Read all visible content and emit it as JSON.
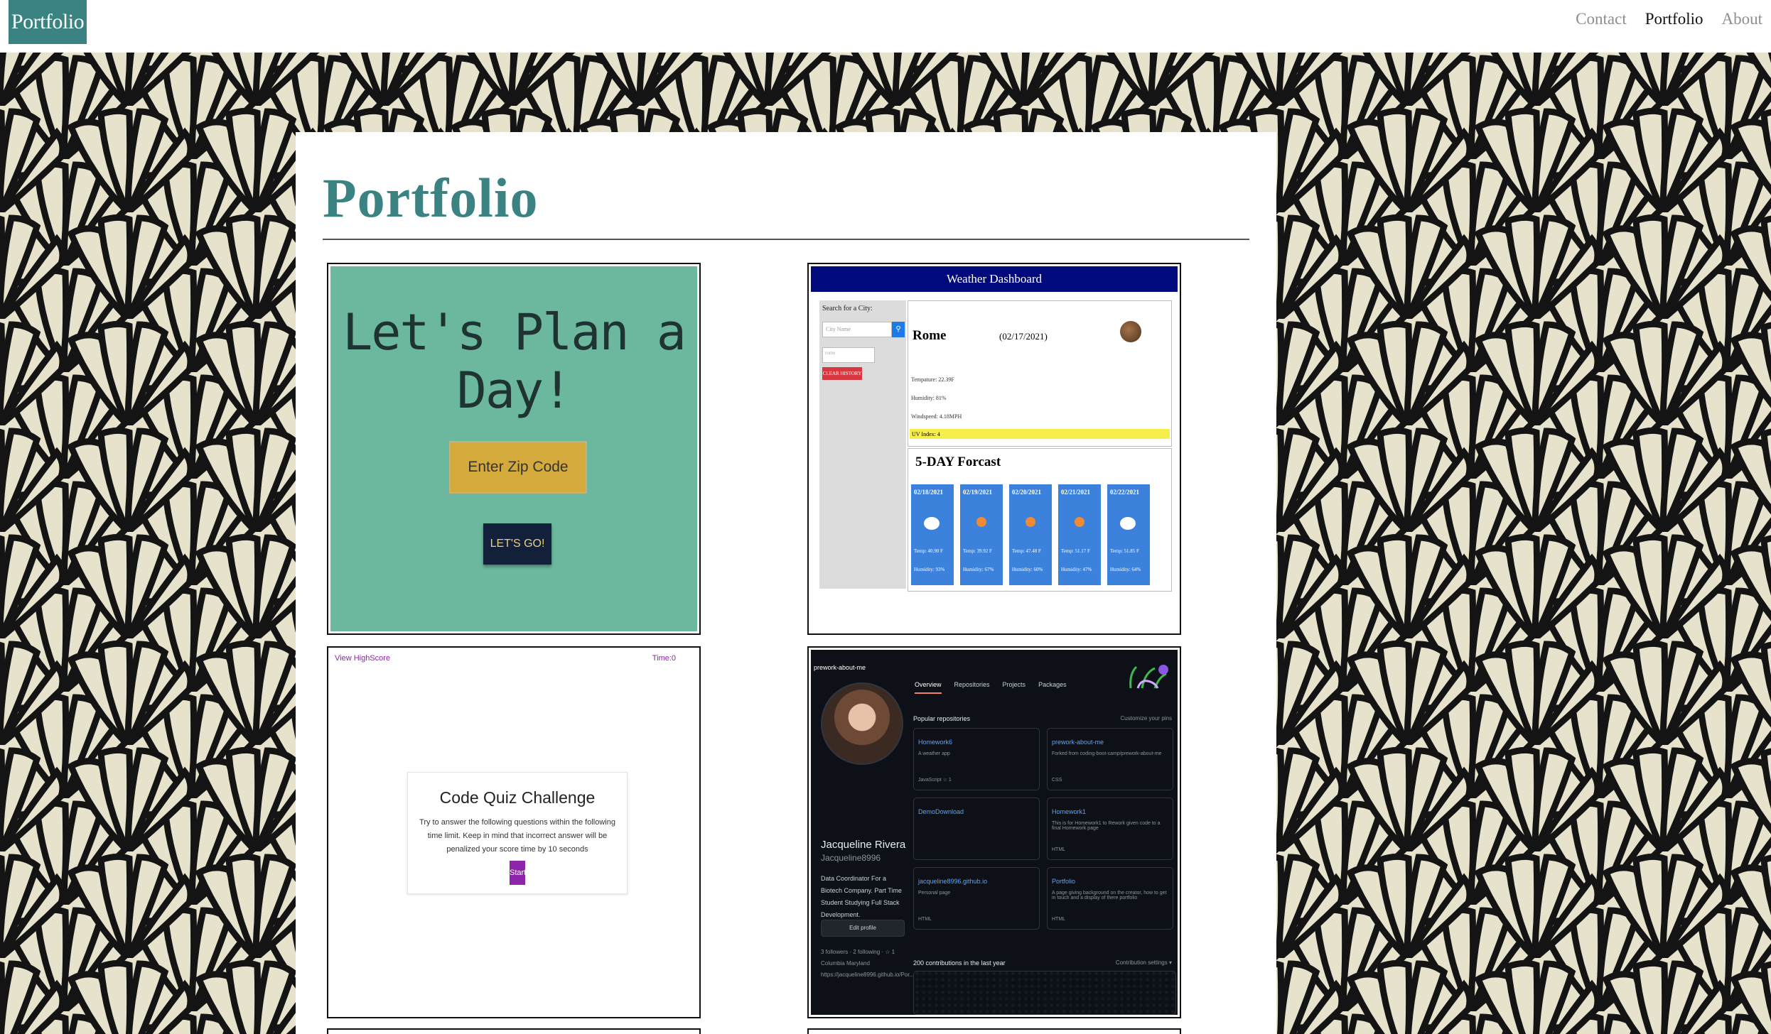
{
  "navbar": {
    "brand": "Portfolio",
    "links": [
      {
        "label": "Contact"
      },
      {
        "label": "Portfolio"
      },
      {
        "label": "About"
      }
    ]
  },
  "page": {
    "title": "Portfolio"
  },
  "projects": {
    "day_planner": {
      "heading": "Let's Plan a Day!",
      "zip_button": "Enter Zip Code",
      "go_button": "LET'S GO!"
    },
    "weather": {
      "header": "Weather Dashboard",
      "search_label": "Search for a City:",
      "search_placeholder": "City Name",
      "history_value": "rome",
      "clear_button": "CLEAR HISTORY",
      "city": "Rome",
      "date": "(02/17/2021)",
      "temperature": "Tempature: 22.39F",
      "humidity": "Humidity: 81%",
      "windspeed": "Windspeed: 4.18MPH",
      "uv": "UV Index: 4",
      "forecast_title": "5-DAY Forcast",
      "forecast": [
        {
          "date": "02/18/2021",
          "temp": "Temp: 40.90 F",
          "humidity": "Humidity: 93%"
        },
        {
          "date": "02/19/2021",
          "temp": "Temp: 39.92 F",
          "humidity": "Humidity: 67%"
        },
        {
          "date": "02/20/2021",
          "temp": "Temp: 47.48 F",
          "humidity": "Humidity: 60%"
        },
        {
          "date": "02/21/2021",
          "temp": "Temp: 51.17 F",
          "humidity": "Humidity: 47%"
        },
        {
          "date": "02/22/2021",
          "temp": "Temp: 51.85 F",
          "humidity": "Humidity: 64%"
        }
      ]
    },
    "quiz": {
      "view_highscore": "View HighScore",
      "time": "Time:0",
      "title": "Code Quiz Challenge",
      "body": "Try to answer the following questions within the following time limit. Keep in mind that incorrect answer will be penalized your score time by 10 seconds",
      "start": "Start"
    },
    "github": {
      "repo_title": "prework-about-me",
      "tabs": [
        "Overview",
        "Repositories",
        "Projects",
        "Packages"
      ],
      "name": "Jacqueline Rivera",
      "username": "Jacqueline8996",
      "bio": "Data Coordinator For a Biotech Company. Part Time Student Studying Full Stack Development.",
      "edit_profile": "Edit profile",
      "followers": "3 followers · 2 following · ☆ 1",
      "location": "Columbia Maryland",
      "website": "https://jacqueline8996.github.io/Por...",
      "popular": "Popular repositories",
      "customize": "Customize your pins",
      "repos": [
        {
          "name": "Homework6",
          "desc": "A weather app",
          "lang": "JavaScript  ☆ 1"
        },
        {
          "name": "prework-about-me",
          "desc": "Forked from coding-boot-camp/prework-about-me",
          "lang": "CSS"
        },
        {
          "name": "DemoDownload",
          "desc": "",
          "lang": ""
        },
        {
          "name": "Homework1",
          "desc": "This is for Homework1 to Rework given code to a final Homework page",
          "lang": "HTML"
        },
        {
          "name": "jacqueline8996.github.io",
          "desc": "Personal page",
          "lang": "HTML"
        },
        {
          "name": "Portfolio",
          "desc": "A page giving background on the creator, how to get in touch and a display of there portfolio",
          "lang": "HTML"
        }
      ],
      "contributions": "200 contributions in the last year",
      "contrib_settings": "Contribution settings ▾"
    }
  },
  "colors": {
    "brand_bg": "#3b8283",
    "title": "#3b8283"
  }
}
